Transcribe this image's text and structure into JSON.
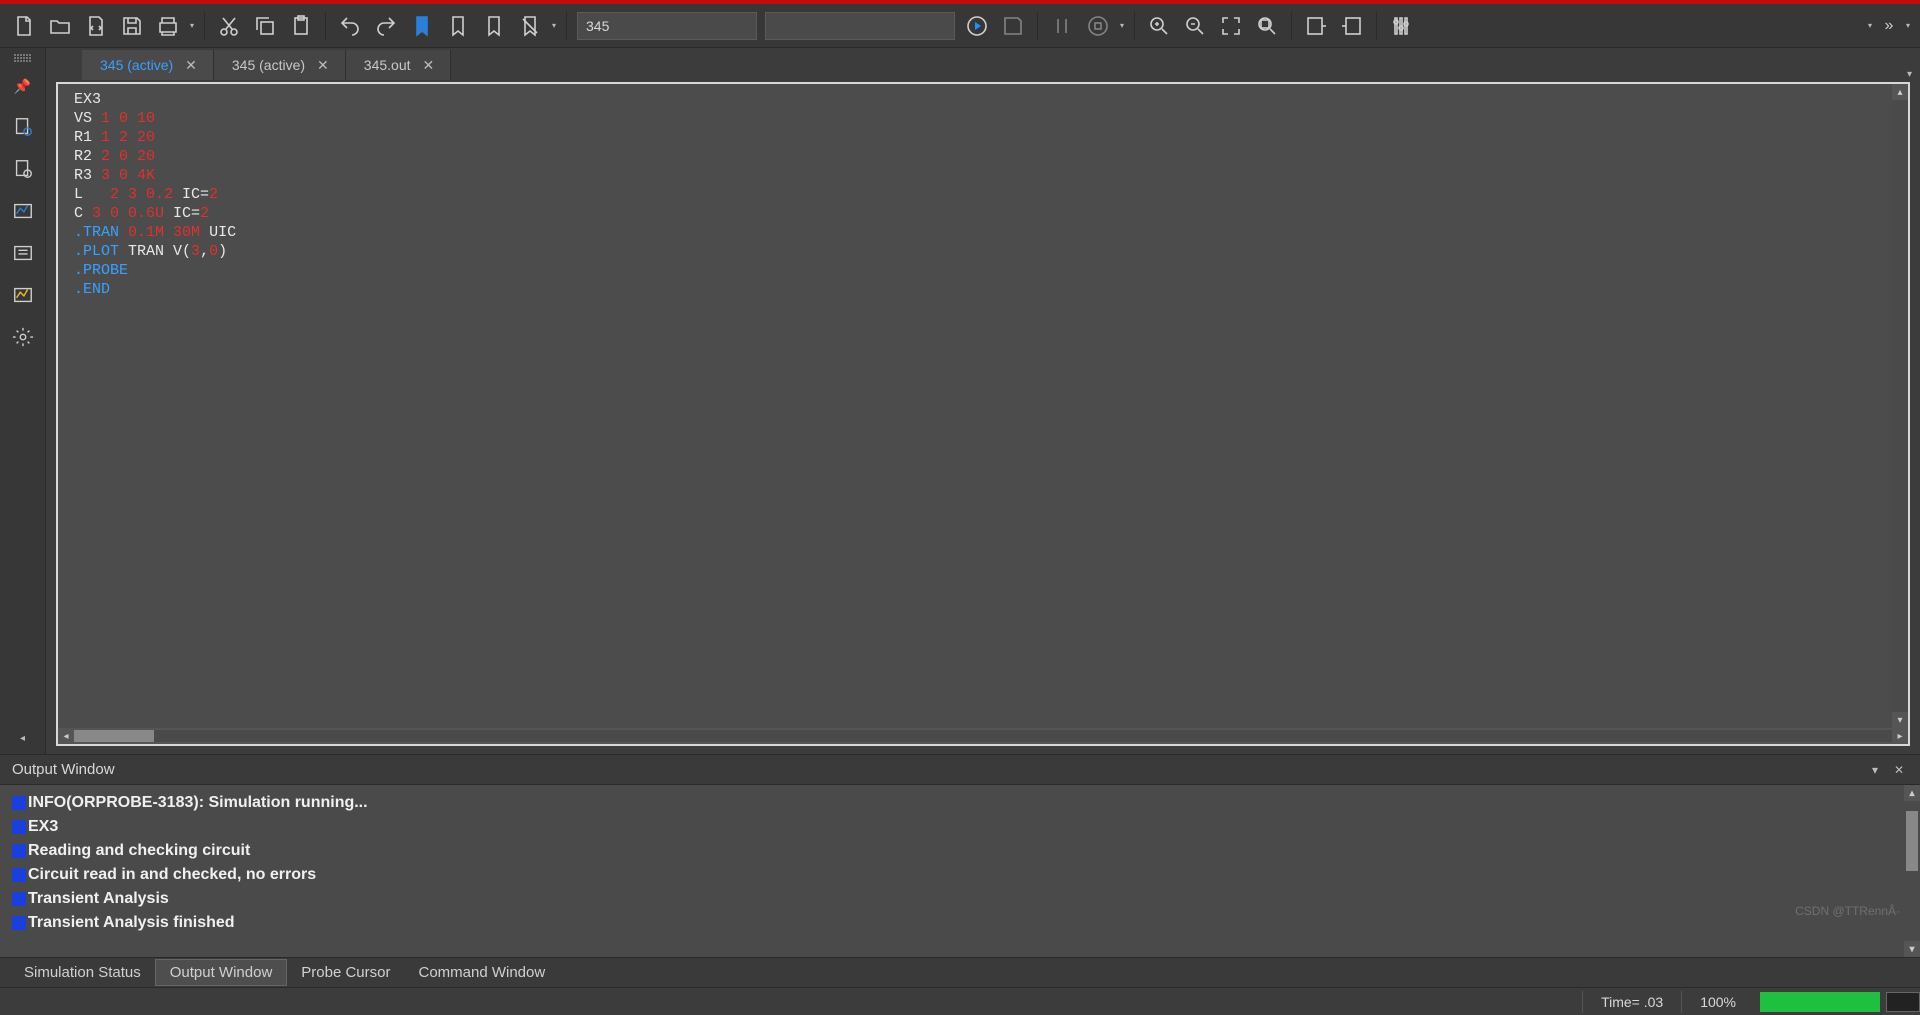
{
  "toolbar": {
    "search_value": "345",
    "command_value": ""
  },
  "tabs": [
    {
      "label": "345 (active)",
      "active": true
    },
    {
      "label": "345 (active)",
      "active": false
    },
    {
      "label": "345.out",
      "active": false
    }
  ],
  "editor": {
    "lines": [
      {
        "t": [
          {
            "c": "plain",
            "v": "EX3"
          }
        ]
      },
      {
        "t": [
          {
            "c": "plain",
            "v": "VS "
          },
          {
            "c": "num",
            "v": "1 0 10"
          }
        ]
      },
      {
        "t": [
          {
            "c": "plain",
            "v": "R1 "
          },
          {
            "c": "num",
            "v": "1 2 20"
          }
        ]
      },
      {
        "t": [
          {
            "c": "plain",
            "v": "R2 "
          },
          {
            "c": "num",
            "v": "2 0 20"
          }
        ]
      },
      {
        "t": [
          {
            "c": "plain",
            "v": "R3 "
          },
          {
            "c": "num",
            "v": "3 0 4K"
          }
        ]
      },
      {
        "t": [
          {
            "c": "plain",
            "v": "L   "
          },
          {
            "c": "num",
            "v": "2 3 0.2"
          },
          {
            "c": "plain",
            "v": " IC="
          },
          {
            "c": "num",
            "v": "2"
          }
        ]
      },
      {
        "t": [
          {
            "c": "plain",
            "v": "C "
          },
          {
            "c": "num",
            "v": "3 0 0.6U"
          },
          {
            "c": "plain",
            "v": " IC="
          },
          {
            "c": "num",
            "v": "2"
          }
        ]
      },
      {
        "t": [
          {
            "c": "dot",
            "v": "."
          },
          {
            "c": "cmd",
            "v": "TRAN"
          },
          {
            "c": "plain",
            "v": " "
          },
          {
            "c": "num",
            "v": "0.1M 30M"
          },
          {
            "c": "plain",
            "v": " UIC"
          }
        ]
      },
      {
        "t": [
          {
            "c": "dot",
            "v": "."
          },
          {
            "c": "cmd",
            "v": "PLOT"
          },
          {
            "c": "plain",
            "v": " TRAN V("
          },
          {
            "c": "num",
            "v": "3"
          },
          {
            "c": "plain",
            "v": ","
          },
          {
            "c": "num",
            "v": "0"
          },
          {
            "c": "plain",
            "v": ")"
          }
        ]
      },
      {
        "t": [
          {
            "c": "dot",
            "v": "."
          },
          {
            "c": "cmd",
            "v": "PROBE"
          }
        ]
      },
      {
        "t": [
          {
            "c": "dot",
            "v": "."
          },
          {
            "c": "cmd",
            "v": "END"
          }
        ]
      }
    ]
  },
  "output": {
    "title": "Output Window",
    "lines": [
      "INFO(ORPROBE-3183): Simulation running...",
      "EX3",
      "Reading and checking circuit",
      "Circuit read in and checked, no errors",
      "Transient Analysis",
      "Transient Analysis finished"
    ]
  },
  "bottom_tabs": [
    {
      "label": "Simulation Status",
      "active": false
    },
    {
      "label": "Output Window",
      "active": true
    },
    {
      "label": "Probe Cursor",
      "active": false
    },
    {
      "label": "Command Window",
      "active": false
    }
  ],
  "status": {
    "time_label": "Time= .03",
    "zoom": "100%"
  },
  "watermark": "CSDN @TTRennÂ·"
}
